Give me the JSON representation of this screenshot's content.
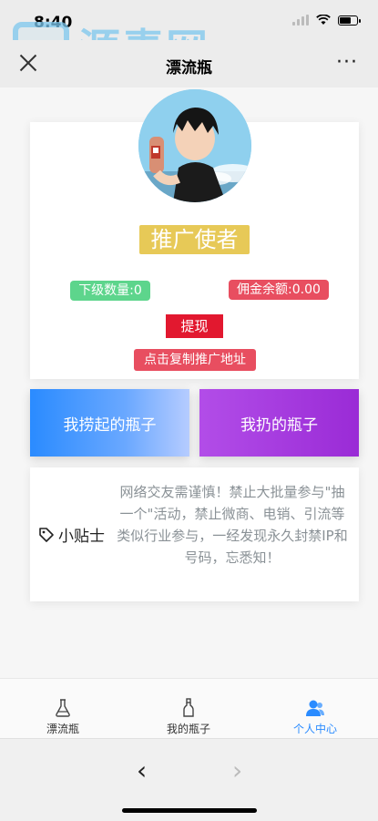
{
  "status": {
    "time": "8:40"
  },
  "watermark": {
    "text": "源素网"
  },
  "nav": {
    "title": "漂流瓶",
    "more": "···"
  },
  "profile": {
    "role": "推广使者",
    "subordinate_count": "下级数量:0",
    "commission_balance": "佣金余额:0.00",
    "withdraw_label": "提现",
    "copy_link_label": "点击复制推广地址"
  },
  "actions": {
    "picked_label": "我捞起的瓶子",
    "thrown_label": "我扔的瓶子"
  },
  "tips": {
    "label": "小贴士",
    "text": "网络交友需谨慎！禁止大批量参与\"抽一个\"活动，禁止微商、电销、引流等类似行业参与，一经发现永久封禁IP和号码，忘悉知！"
  },
  "tabbar": {
    "items": [
      {
        "label": "漂流瓶"
      },
      {
        "label": "我的瓶子"
      },
      {
        "label": "个人中心"
      }
    ],
    "active_color": "#2a8bff"
  },
  "colors": {
    "role_badge": "#e7c957",
    "subordinate": "#5dd58c",
    "commission": "#e84e60",
    "withdraw": "#e2182f"
  }
}
